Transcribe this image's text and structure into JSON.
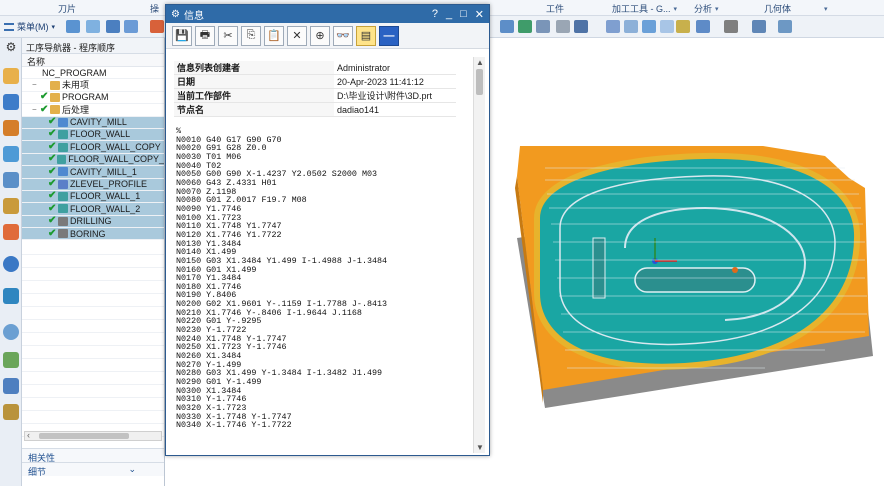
{
  "ribbon": {
    "groups": [
      {
        "label": "刀片"
      },
      {
        "label": "操"
      },
      {
        "label": "工件"
      },
      {
        "label": "加工工具 - G..."
      },
      {
        "label": "分析"
      },
      {
        "label": "几何体"
      }
    ],
    "menu_label": "菜单(M)"
  },
  "navigator": {
    "title": "工序导航器 - 程序顺序",
    "column_header": "名称",
    "tree": [
      {
        "label": "NC_PROGRAM",
        "check": "",
        "selected": false,
        "indent": 0
      },
      {
        "label": "未用项",
        "check": "",
        "selected": false,
        "indent": 1
      },
      {
        "label": "PROGRAM",
        "check": "✔",
        "selected": false,
        "indent": 2
      },
      {
        "label": "后处理",
        "check": "✔",
        "selected": false,
        "indent": 1
      },
      {
        "label": "CAVITY_MILL",
        "check": "✔",
        "selected": true,
        "indent": 3
      },
      {
        "label": "FLOOR_WALL",
        "check": "✔",
        "selected": true,
        "indent": 3
      },
      {
        "label": "FLOOR_WALL_COPY",
        "check": "✔",
        "selected": true,
        "indent": 3
      },
      {
        "label": "FLOOR_WALL_COPY_",
        "check": "✔",
        "selected": true,
        "indent": 3
      },
      {
        "label": "CAVITY_MILL_1",
        "check": "✔",
        "selected": true,
        "indent": 3
      },
      {
        "label": "ZLEVEL_PROFILE",
        "check": "✔",
        "selected": true,
        "indent": 3
      },
      {
        "label": "FLOOR_WALL_1",
        "check": "✔",
        "selected": true,
        "indent": 3
      },
      {
        "label": "FLOOR_WALL_2",
        "check": "✔",
        "selected": true,
        "indent": 3
      },
      {
        "label": "DRILLING",
        "check": "✔",
        "selected": true,
        "indent": 3
      },
      {
        "label": "BORING",
        "check": "✔",
        "selected": true,
        "indent": 3
      }
    ],
    "panels": {
      "dependencies": "相关性",
      "details": "细节"
    }
  },
  "dialog": {
    "title": "信息",
    "title_controls": {
      "help": "?",
      "minimize": "_",
      "maximize": "□",
      "close": "✕"
    },
    "toolbar_buttons": [
      {
        "icon": "save-icon",
        "glyph": "💾",
        "active": false,
        "blue": false
      },
      {
        "icon": "print-icon",
        "glyph": "🖶",
        "active": false,
        "blue": false
      },
      {
        "icon": "cut-icon",
        "glyph": "✂",
        "active": false,
        "blue": false
      },
      {
        "icon": "copy-icon",
        "glyph": "⎘",
        "active": false,
        "blue": false
      },
      {
        "icon": "paste-icon",
        "glyph": "📋",
        "active": false,
        "blue": false
      },
      {
        "icon": "delete-icon",
        "glyph": "✕",
        "active": false,
        "blue": false
      },
      {
        "icon": "add-icon",
        "glyph": "⊕",
        "active": false,
        "blue": false
      },
      {
        "icon": "view-icon",
        "glyph": "👓",
        "active": false,
        "blue": false
      },
      {
        "icon": "wrap-icon",
        "glyph": "▤",
        "active": true,
        "blue": false
      },
      {
        "icon": "minus-icon",
        "glyph": "—",
        "active": false,
        "blue": true
      }
    ],
    "info": [
      {
        "key": "信息列表创建者",
        "value": "Administrator"
      },
      {
        "key": "日期",
        "value": "20-Apr-2023 11:41:12"
      },
      {
        "key": "当前工作部件",
        "value": "D:\\毕业设计\\附件\\3D.prt"
      },
      {
        "key": "节点名",
        "value": "dadiao141"
      }
    ],
    "code_lines": [
      "%",
      "N0010 G40 G17 G90 G70",
      "N0020 G91 G28 Z0.0",
      "N0030 T01 M06",
      "N0040 T02",
      "N0050 G00 G90 X-1.4237 Y2.0502 S2000 M03",
      "N0060 G43 Z.4331 H01",
      "N0070 Z.1198",
      "N0080 G01 Z.0017 F19.7 M08",
      "N0090 Y1.7746",
      "N0100 X1.7723",
      "N0110 X1.7748 Y1.7747",
      "N0120 X1.7746 Y1.7722",
      "N0130 Y1.3484",
      "N0140 X1.499",
      "N0150 G03 X1.3484 Y1.499 I-1.4988 J-1.3484",
      "N0160 G01 X1.499",
      "N0170 Y1.3484",
      "N0180 X1.7746",
      "N0190 Y.8406",
      "N0200 G02 X1.9601 Y-.1159 I-1.7788 J-.8413",
      "N0210 X1.7746 Y-.8406 I-1.9644 J.1168",
      "N0220 G01 Y-.9295",
      "N0230 Y-1.7722",
      "N0240 X1.7748 Y-1.7747",
      "N0250 X1.7723 Y-1.7746",
      "N0260 X1.3484",
      "N0270 Y-1.499",
      "N0280 G03 X1.499 Y-1.3484 I-1.3482 J1.499",
      "N0290 G01 Y-1.499",
      "N0300 X1.3484",
      "N0310 Y-1.7746",
      "N0320 X-1.7723",
      "N0330 X-1.7748 Y-1.7747",
      "N0340 X-1.7746 Y-1.7722"
    ]
  },
  "graphics": {
    "colors": {
      "part_cyan": "#1aa6a3",
      "stock_orange": "#f29a1f",
      "toolpath": "#d9e8ef",
      "base_gray": "#9a9a9a"
    }
  }
}
